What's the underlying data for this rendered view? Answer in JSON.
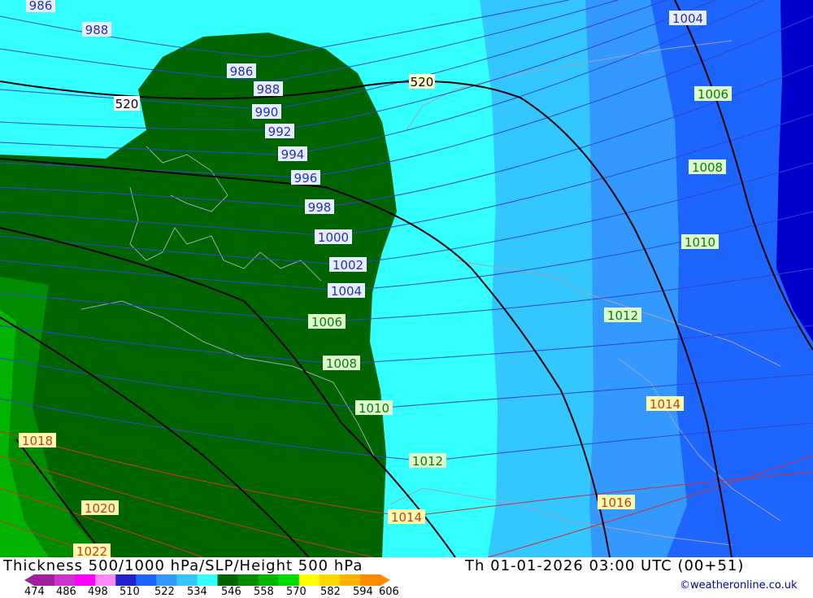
{
  "map": {
    "title": "Thickness 500/1000 hPa/SLP/Height 500 hPa",
    "valid_time": "Th 01-01-2026 03:00 UTC (00+51)",
    "credit": "©weatheronline.co.uk",
    "height_contour_labels": [
      "520",
      "520"
    ],
    "isobar_labels_blue": [
      "986",
      "988",
      "986",
      "988",
      "990",
      "992",
      "994",
      "996",
      "998",
      "1000",
      "1002",
      "1004"
    ],
    "isobar_labels_green": [
      "1004",
      "1006",
      "1008",
      "1010",
      "1012",
      "1006",
      "1008",
      "1010",
      "1012"
    ],
    "isobar_labels_red": [
      "1014",
      "1014",
      "1016",
      "1018",
      "1020",
      "1022"
    ],
    "legend": {
      "ticks": [
        "474",
        "486",
        "498",
        "510",
        "522",
        "534",
        "546",
        "558",
        "570",
        "582",
        "594",
        "606"
      ],
      "colors": [
        "#a020a0",
        "#cc33cc",
        "#ff00ff",
        "#ff88ff",
        "#2222cc",
        "#1e64ff",
        "#3399ff",
        "#33c6ff",
        "#33ffff",
        "#006400",
        "#008c00",
        "#00b400",
        "#00dc00",
        "#ffff00",
        "#ffd700",
        "#ffb400",
        "#ff8c00"
      ]
    },
    "colors": {
      "cyan": "#33ffff",
      "light_blue": "#33c6ff",
      "mid_blue": "#3399ff",
      "blue": "#1e64ff",
      "dark_blue": "#0000cc",
      "dark_green": "#006400",
      "green": "#008c00",
      "bright_green": "#00b400"
    }
  }
}
